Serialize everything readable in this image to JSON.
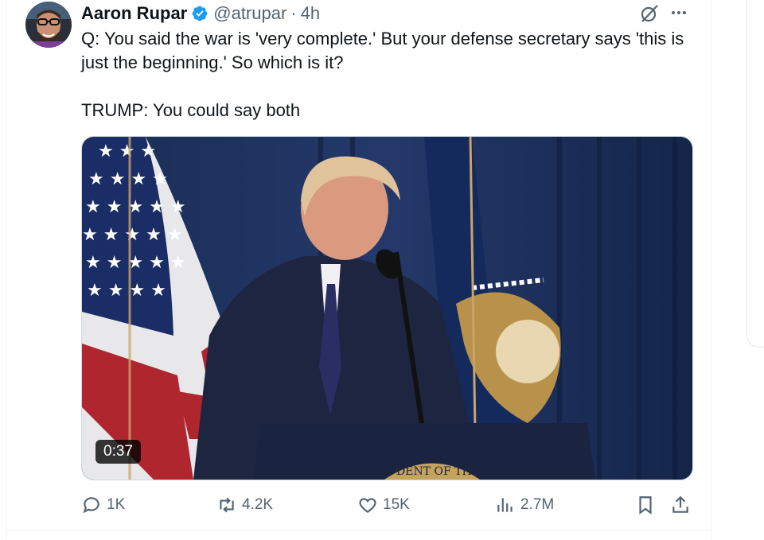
{
  "tweet": {
    "author_name": "Aaron Rupar",
    "handle": "@atrupar",
    "separator": "·",
    "time": "4h",
    "text_line1": "Q: You said the war is 'very complete.' But your defense secretary says 'this is just the beginning.' So which is it?",
    "text_line2": "TRUMP: You could say both",
    "video_duration": "0:37"
  },
  "actions": {
    "replies": "1K",
    "reposts": "4.2K",
    "likes": "15K",
    "views": "2.7M"
  },
  "colors": {
    "text": "#0f1419",
    "muted": "#536471",
    "verified": "#1d9bf0",
    "border": "#eff3f4"
  },
  "icons": [
    "verified-badge-icon",
    "grok-icon",
    "more-icon",
    "reply-icon",
    "repost-icon",
    "like-icon",
    "views-icon",
    "bookmark-icon",
    "share-icon"
  ]
}
